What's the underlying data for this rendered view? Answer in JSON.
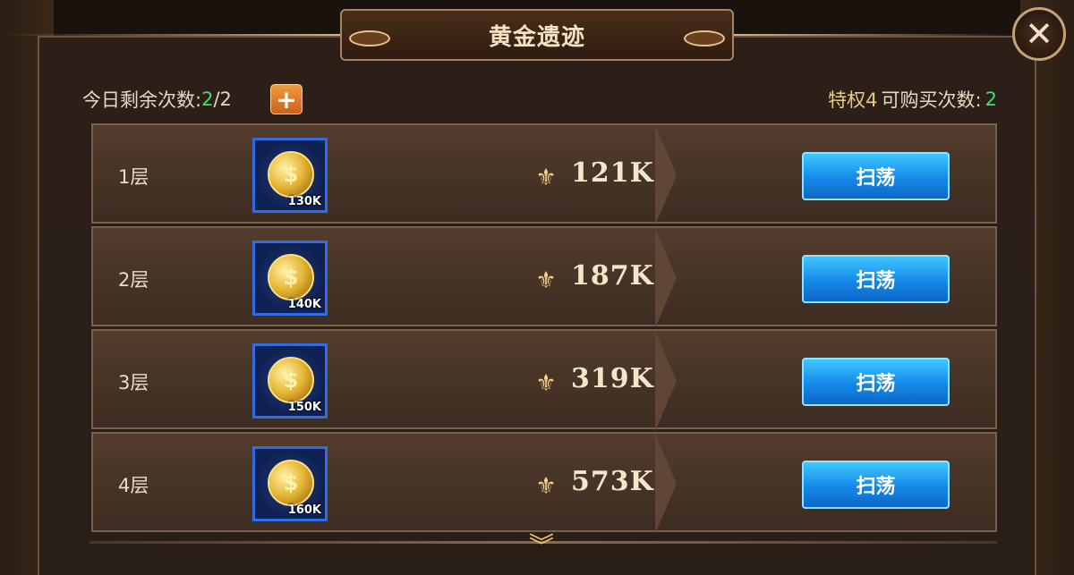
{
  "title": "黄金遗迹",
  "close_icon": "✕",
  "remaining": {
    "label": "今日剩余次数:",
    "current": "2",
    "separator": "/",
    "max": "2"
  },
  "add_icon": "+",
  "privilege": {
    "level": "特权4",
    "label": "可购买次数:",
    "count": "2"
  },
  "rows": [
    {
      "floor": "1层",
      "reward_qty": "130K",
      "power": "121K",
      "button": "扫荡"
    },
    {
      "floor": "2层",
      "reward_qty": "140K",
      "power": "187K",
      "button": "扫荡"
    },
    {
      "floor": "3层",
      "reward_qty": "150K",
      "power": "319K",
      "button": "扫荡"
    },
    {
      "floor": "4层",
      "reward_qty": "160K",
      "power": "573K",
      "button": "扫荡"
    }
  ],
  "icons": {
    "coin": "coin-icon",
    "power": "power-icon",
    "scroll": "chevron-down-icon"
  },
  "colors": {
    "accent_green": "#3ee16b",
    "button_blue": "#1589e8",
    "gold": "#f4d089"
  }
}
